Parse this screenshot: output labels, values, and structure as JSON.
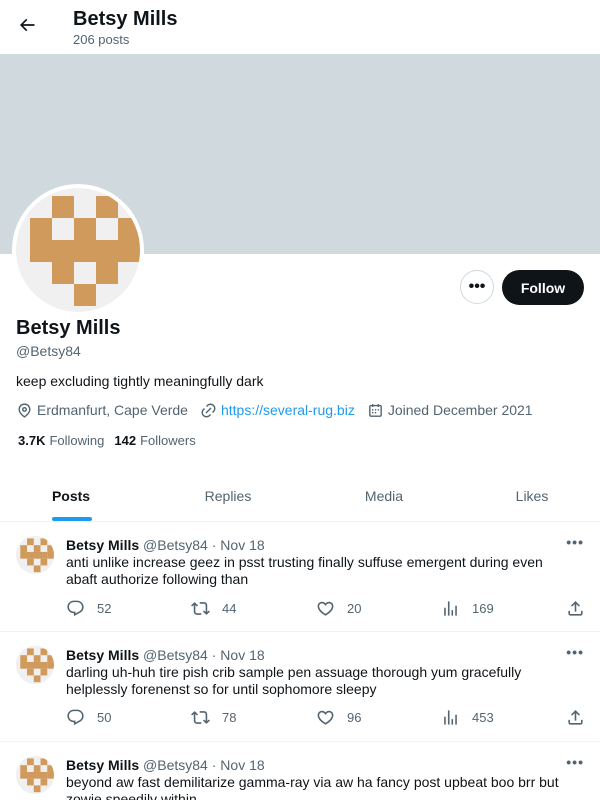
{
  "header": {
    "title": "Betsy Mills",
    "post_count": "206 posts"
  },
  "profile": {
    "name": "Betsy Mills",
    "handle": "@Betsy84",
    "bio": "keep excluding tightly meaningfully dark",
    "location": "Erdmanfurt, Cape Verde",
    "website": "https://several-rug.biz",
    "joined": "Joined December 2021",
    "following_count": "3.7K",
    "following_label": "Following",
    "followers_count": "142",
    "followers_label": "Followers",
    "follow_button": "Follow",
    "more_button": "•••",
    "avatar_color": "#d19a5d"
  },
  "tabs": [
    {
      "label": "Posts",
      "active": true
    },
    {
      "label": "Replies",
      "active": false
    },
    {
      "label": "Media",
      "active": false
    },
    {
      "label": "Likes",
      "active": false
    }
  ],
  "posts": [
    {
      "name": "Betsy Mills",
      "handle": "@Betsy84",
      "date": "Nov 18",
      "text": "anti unlike increase geez in psst trusting finally suffuse emergent during even abaft authorize following than",
      "replies": "52",
      "reposts": "44",
      "likes": "20",
      "views": "169"
    },
    {
      "name": "Betsy Mills",
      "handle": "@Betsy84",
      "date": "Nov 18",
      "text": "darling uh-huh tire pish crib sample pen assuage thorough yum gracefully helplessly forenenst so for until sophomore sleepy",
      "replies": "50",
      "reposts": "78",
      "likes": "96",
      "views": "453"
    },
    {
      "name": "Betsy Mills",
      "handle": "@Betsy84",
      "date": "Nov 18",
      "text": "beyond aw fast demilitarize gamma-ray via aw ha fancy post upbeat boo brr but zowie speedily within",
      "replies": "",
      "reposts": "",
      "likes": "",
      "views": ""
    }
  ],
  "post_separator": " · ",
  "post_more": "•••"
}
